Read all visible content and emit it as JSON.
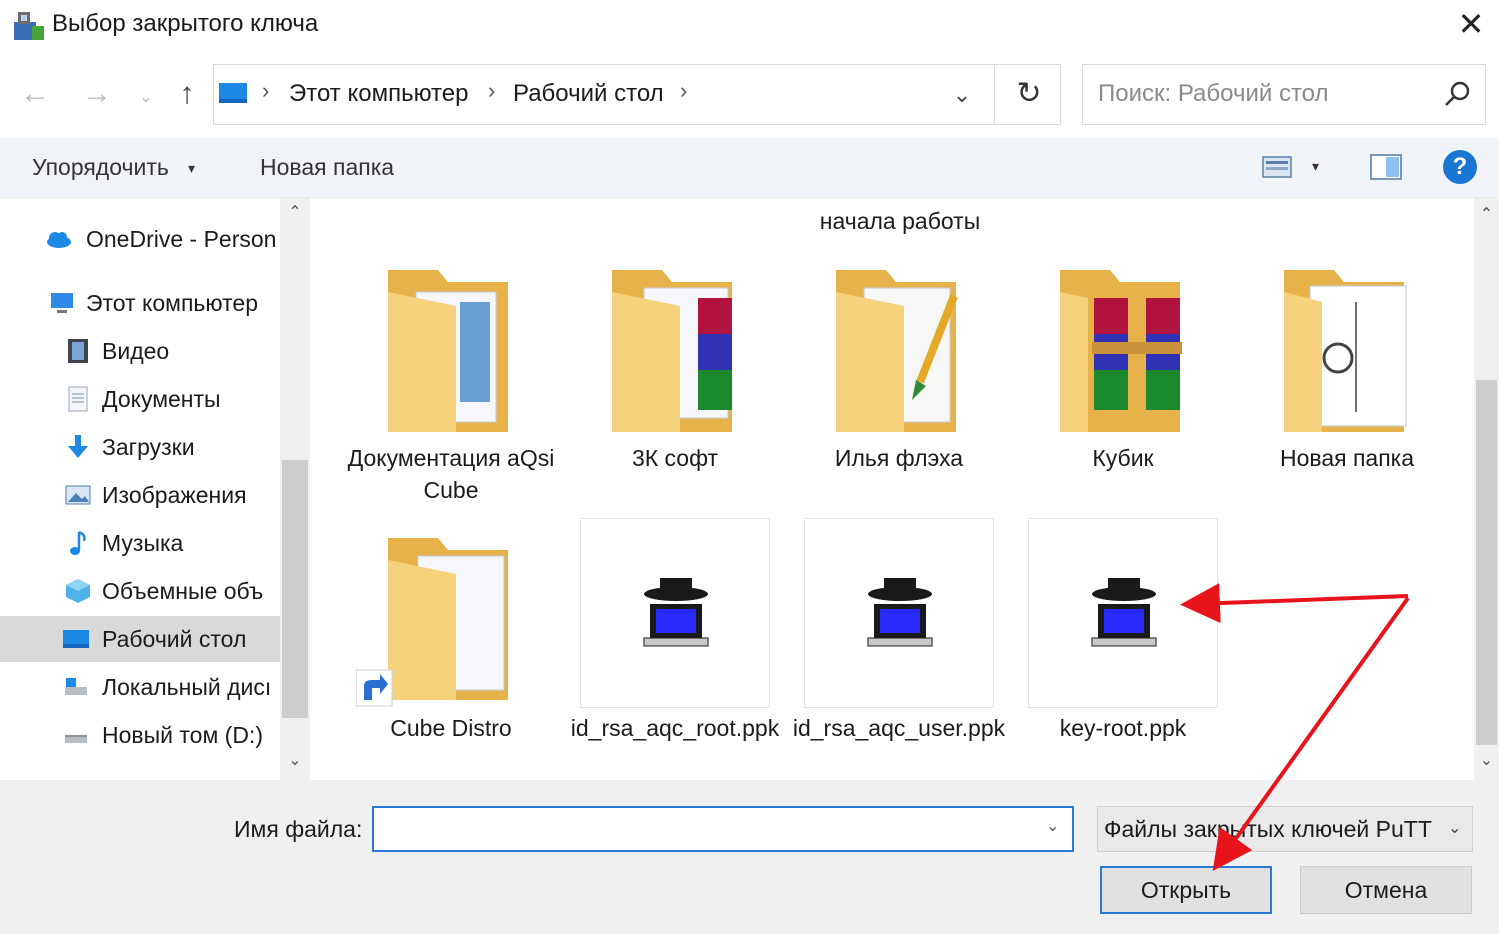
{
  "window": {
    "title": "Выбор закрытого ключа",
    "close_glyph": "✕"
  },
  "nav": {
    "back_glyph": "←",
    "forward_glyph": "→",
    "recent_glyph": "⌄",
    "up_glyph": "↑",
    "breadcrumb": [
      "Этот компьютер",
      "Рабочий стол"
    ],
    "separator": "›",
    "dropdown_glyph": "⌄",
    "refresh_glyph": "↻",
    "search_placeholder": "Поиск: Рабочий стол"
  },
  "toolbar": {
    "organize_label": "Упорядочить",
    "caret": "▾",
    "new_folder_label": "Новая папка",
    "help_glyph": "?"
  },
  "sidebar": {
    "items": [
      {
        "label": "OneDrive - Person",
        "icon": "cloud-icon"
      },
      {
        "label": "Этот компьютер",
        "icon": "computer-icon"
      },
      {
        "label": "Видео",
        "icon": "video-icon"
      },
      {
        "label": "Документы",
        "icon": "documents-icon"
      },
      {
        "label": "Загрузки",
        "icon": "downloads-icon"
      },
      {
        "label": "Изображения",
        "icon": "pictures-icon"
      },
      {
        "label": "Музыка",
        "icon": "music-icon"
      },
      {
        "label": "Объемные объ",
        "icon": "3d-objects-icon"
      },
      {
        "label": "Рабочий стол",
        "icon": "desktop-icon",
        "selected": true
      },
      {
        "label": "Локальный дисı",
        "icon": "local-disk-icon"
      },
      {
        "label": "Новый том (D:)",
        "icon": "drive-icon"
      }
    ],
    "scroll_up": "⌃",
    "scroll_down": "⌄"
  },
  "content": {
    "partial_label": "начала работы",
    "folders": [
      {
        "label": "Документация aQsi Cube",
        "icon": "folder-documents-icon"
      },
      {
        "label": "3К софт",
        "icon": "folder-winrar-icon"
      },
      {
        "label": "Илья флэха",
        "icon": "folder-notes-icon"
      },
      {
        "label": "Кубик",
        "icon": "folder-winrar-icon"
      },
      {
        "label": "Новая папка",
        "icon": "folder-images-icon"
      },
      {
        "label": "Cube Distro",
        "icon": "folder-shortcut-icon"
      }
    ],
    "files": [
      {
        "label": "id_rsa_aqc_root.ppk",
        "icon": "putty-key-icon"
      },
      {
        "label": "id_rsa_aqc_user.ppk",
        "icon": "putty-key-icon"
      },
      {
        "label": "key-root.ppk",
        "icon": "putty-key-icon"
      }
    ]
  },
  "bottom": {
    "filename_label": "Имя файла:",
    "filename_value": "",
    "filter_label": "Файлы закрытых ключей PuTT",
    "open_label": "Открыть",
    "cancel_label": "Отмена"
  },
  "colors": {
    "accent": "#2b79d6",
    "annotation_arrow": "#e8141b",
    "folder": "#f3c860"
  }
}
